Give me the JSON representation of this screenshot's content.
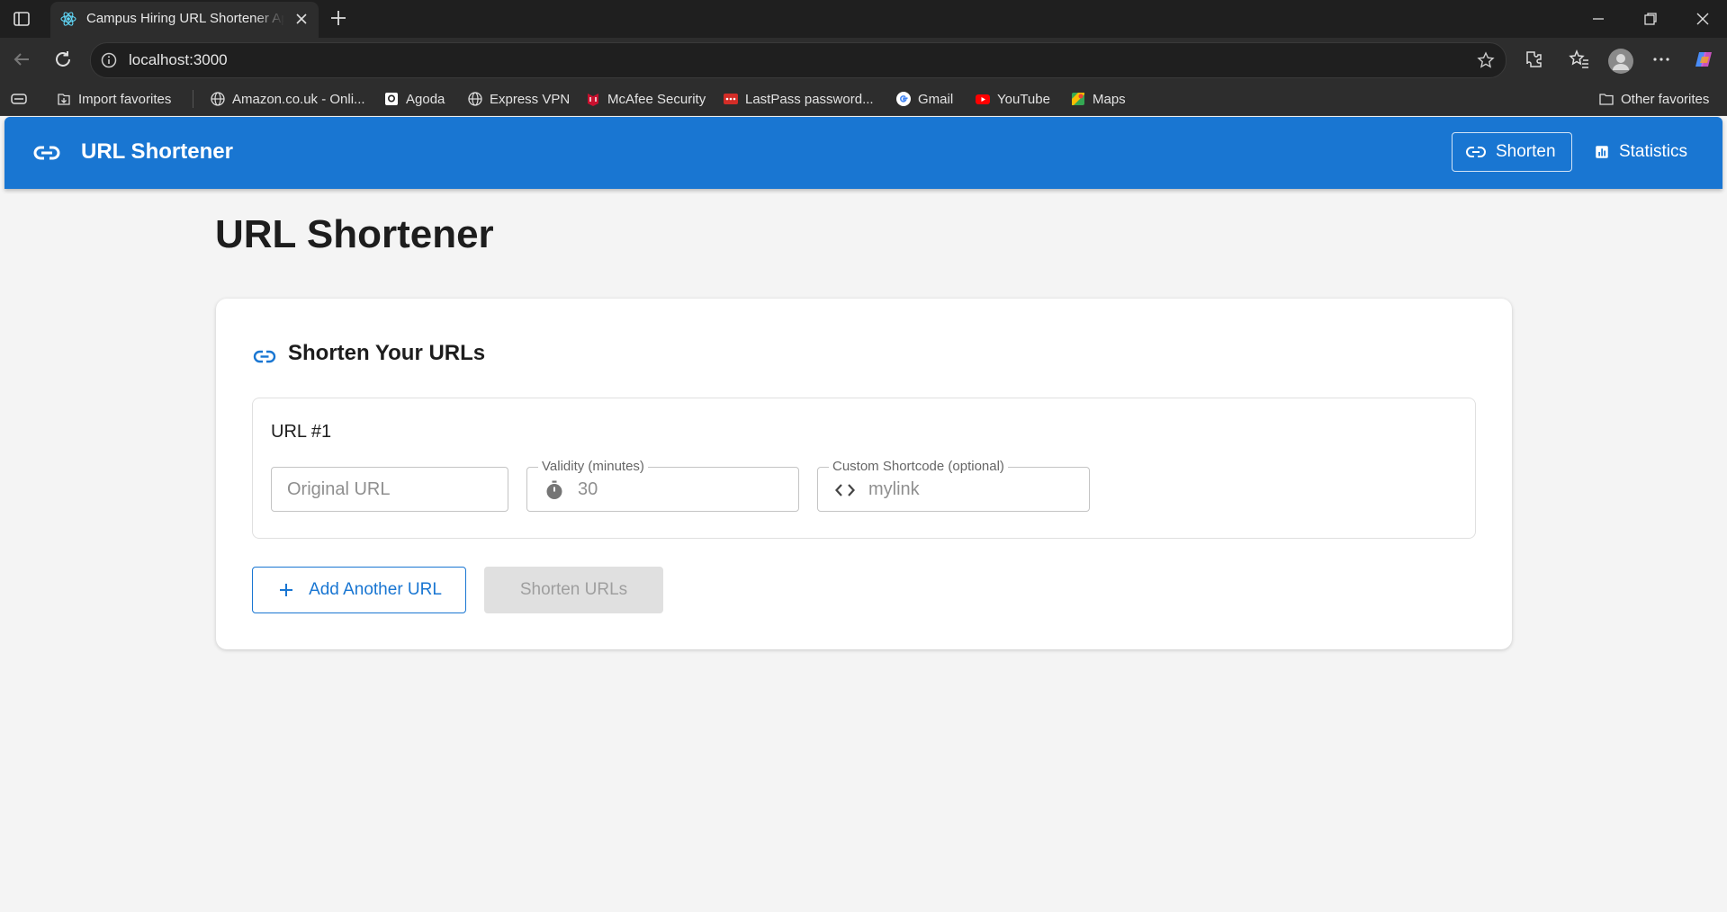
{
  "browser": {
    "tab_title": "Campus Hiring URL Shortener App",
    "address": "localhost:3000",
    "bookmarks": [
      {
        "label": "Import favorites",
        "icon": "import-icon"
      },
      {
        "label": "Amazon.co.uk - Onli...",
        "icon": "globe-icon"
      },
      {
        "label": "Agoda",
        "icon": "agoda-icon"
      },
      {
        "label": "Express VPN",
        "icon": "globe-icon"
      },
      {
        "label": "McAfee Security",
        "icon": "mcafee-icon"
      },
      {
        "label": "LastPass password...",
        "icon": "lastpass-icon"
      },
      {
        "label": "Gmail",
        "icon": "google-icon"
      },
      {
        "label": "YouTube",
        "icon": "youtube-icon"
      },
      {
        "label": "Maps",
        "icon": "maps-icon"
      }
    ],
    "other_favorites": "Other favorites"
  },
  "appbar": {
    "title": "URL Shortener",
    "nav": {
      "shorten": "Shorten",
      "statistics": "Statistics"
    },
    "color": "#1976d2"
  },
  "page": {
    "title": "URL Shortener"
  },
  "card": {
    "title": "Shorten Your URLs",
    "entries": [
      {
        "label": "URL #1",
        "original_url": {
          "value": "",
          "placeholder": "Original URL"
        },
        "validity": {
          "legend": "Validity (minutes)",
          "value": "",
          "placeholder": "30",
          "icon": "timer-icon"
        },
        "shortcode": {
          "legend": "Custom Shortcode (optional)",
          "value": "",
          "placeholder": "mylink",
          "icon": "code-icon"
        }
      }
    ],
    "add_button": "Add Another URL",
    "submit_button": "Shorten URLs"
  }
}
